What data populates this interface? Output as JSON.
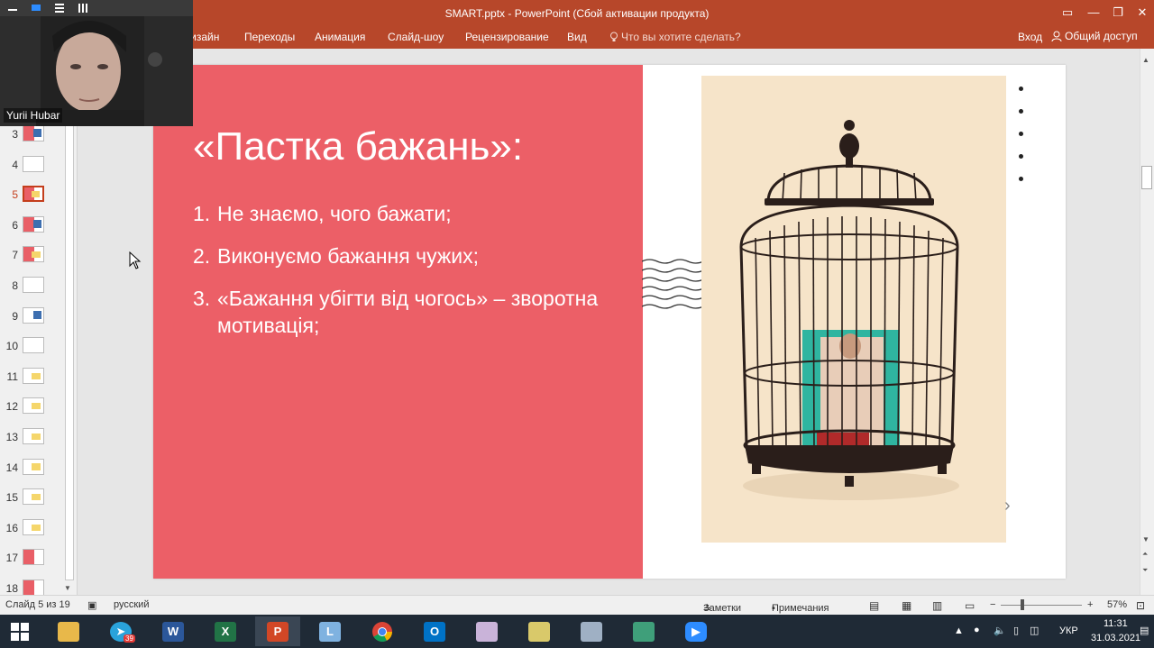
{
  "window": {
    "title": "SMART.pptx - PowerPoint (Сбой активации продукта)"
  },
  "ribbon": {
    "tabs": [
      "Дизайн",
      "Переходы",
      "Анимация",
      "Слайд-шоу",
      "Рецензирование",
      "Вид"
    ],
    "tell_me": "Что вы хотите сделать?",
    "sign_in": "Вход",
    "share": "Общий доступ"
  },
  "sidebar": {
    "thumbnails": [
      {
        "num": "3"
      },
      {
        "num": "4"
      },
      {
        "num": "5"
      },
      {
        "num": "6"
      },
      {
        "num": "7"
      },
      {
        "num": "8"
      },
      {
        "num": "9"
      },
      {
        "num": "10"
      },
      {
        "num": "11"
      },
      {
        "num": "12"
      },
      {
        "num": "13"
      },
      {
        "num": "14"
      },
      {
        "num": "15"
      },
      {
        "num": "16"
      },
      {
        "num": "17"
      },
      {
        "num": "18"
      }
    ],
    "active": "5"
  },
  "slide": {
    "title": "«Пастка бажань»:",
    "items": [
      {
        "num": "1.",
        "text": "Не знаємо, чого бажати;"
      },
      {
        "num": "2.",
        "text": "Виконуємо бажання чужих;"
      },
      {
        "num": "3.",
        "text": "«Бажання убігти від чогось» – зворотна мотивація;"
      }
    ],
    "accent_color": "#ec5f67"
  },
  "statusbar": {
    "slide_info": "Слайд 5 из 19",
    "language": "русский",
    "notes": "Заметки",
    "comments": "Примечания",
    "zoom": "57%"
  },
  "taskbar": {
    "telegram_badge": "39",
    "language": "УКР",
    "time": "11:31",
    "date": "31.03.2021"
  },
  "webcam": {
    "participant": "Yurii Hubar"
  }
}
